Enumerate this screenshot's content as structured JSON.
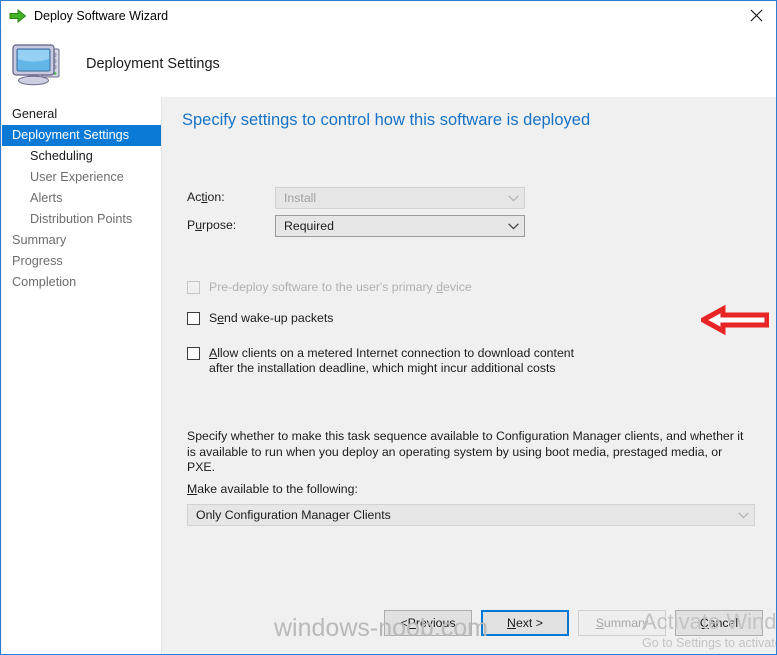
{
  "window": {
    "title": "Deploy Software Wizard",
    "title_icon": "green-right-arrow-icon",
    "close_icon": "close-icon",
    "border_color": "#2b7dd1"
  },
  "header": {
    "icon": "computer-icon",
    "title": "Deployment Settings"
  },
  "sidebar": {
    "items": [
      {
        "label": "General",
        "level": 1,
        "state": "enabled"
      },
      {
        "label": "Deployment Settings",
        "level": 1,
        "state": "selected"
      },
      {
        "label": "Scheduling",
        "level": 2,
        "state": "enabled"
      },
      {
        "label": "User Experience",
        "level": 2,
        "state": "disabled"
      },
      {
        "label": "Alerts",
        "level": 2,
        "state": "disabled"
      },
      {
        "label": "Distribution Points",
        "level": 2,
        "state": "disabled"
      },
      {
        "label": "Summary",
        "level": 1,
        "state": "disabled"
      },
      {
        "label": "Progress",
        "level": 1,
        "state": "disabled"
      },
      {
        "label": "Completion",
        "level": 1,
        "state": "disabled"
      }
    ],
    "selected_color": "#0b7ad6"
  },
  "main": {
    "heading": "Specify settings to control how this software is deployed",
    "heading_color": "#1673c8",
    "action": {
      "label": "Action:",
      "label_accel_prefix": "Ac",
      "label_accel_char": "ti",
      "label_accel_suffix": "on:",
      "value": "Install",
      "enabled": false
    },
    "purpose": {
      "label": "Purpose:",
      "label_accel_prefix": "P",
      "label_accel_char": "u",
      "label_accel_suffix": "rpose:",
      "value": "Required",
      "enabled": true
    },
    "checkboxes": [
      {
        "label_prefix": "Pre-deploy software to the user's primary ",
        "label_accel_char": "d",
        "label_suffix": "evice",
        "checked": false,
        "enabled": false
      },
      {
        "label_prefix": "S",
        "label_accel_char": "e",
        "label_suffix": "nd wake-up packets",
        "checked": false,
        "enabled": true
      },
      {
        "label_prefix": "",
        "label_accel_char": "A",
        "label_suffix": "llow clients on a metered Internet connection to download content after the installation deadline, which might incur additional costs",
        "checked": false,
        "enabled": true
      }
    ],
    "description": "Specify whether to make this task sequence available to Configuration Manager clients, and whether it is available to run when you deploy an operating system by using boot media, prestaged media, or PXE.",
    "make_available": {
      "label_accel_char": "M",
      "label_suffix": "ake available to the following:",
      "value": "Only Configuration Manager Clients",
      "enabled": false
    },
    "annotation": {
      "name": "red-left-arrow-annotation",
      "color": "#e82525",
      "points_to": "purpose-dropdown"
    }
  },
  "footer": {
    "buttons": [
      {
        "prefix": "< ",
        "accel_char": "P",
        "suffix": "revious",
        "state": "enabled"
      },
      {
        "prefix": "",
        "accel_char": "N",
        "suffix": "ext >",
        "state": "focused"
      },
      {
        "prefix": "",
        "accel_char": "S",
        "suffix": "ummary",
        "state": "disabled"
      },
      {
        "prefix": "",
        "accel_char": "C",
        "suffix": "ancel",
        "state": "enabled"
      }
    ]
  },
  "watermarks": {
    "site": "windows-noob.com",
    "activate_title": "Activate Windows",
    "activate_subtitle": "Go to Settings to activate"
  }
}
